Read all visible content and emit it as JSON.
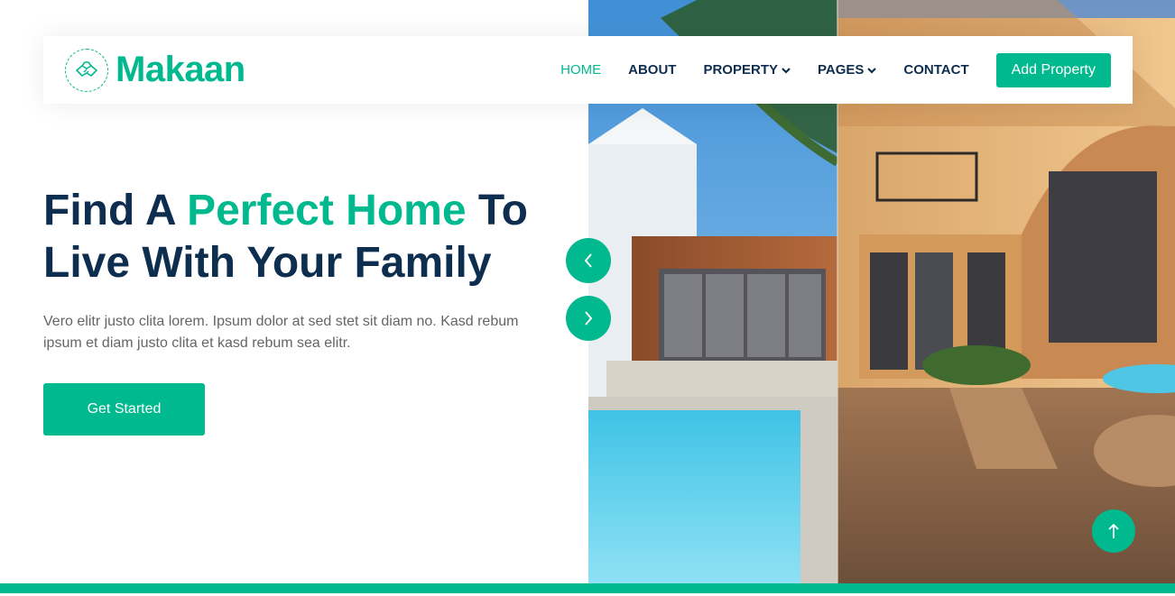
{
  "brand": {
    "name": "Makaan",
    "logo_icon": "handshake-icon"
  },
  "nav": {
    "items": [
      {
        "label": "HOME",
        "active": true,
        "dropdown": false
      },
      {
        "label": "ABOUT",
        "active": false,
        "dropdown": false
      },
      {
        "label": "PROPERTY",
        "active": false,
        "dropdown": true
      },
      {
        "label": "PAGES",
        "active": false,
        "dropdown": true
      },
      {
        "label": "CONTACT",
        "active": false,
        "dropdown": false
      }
    ],
    "cta_label": "Add Property"
  },
  "hero": {
    "title_part1": "Find A ",
    "title_accent": "Perfect Home",
    "title_part2": " To Live With Your Family",
    "text": "Vero elitr justo clita lorem. Ipsum dolor at sed stet sit diam no. Kasd rebum ipsum et diam justo clita et kasd rebum sea elitr.",
    "button_label": "Get Started"
  },
  "carousel": {
    "prev_icon": "chevron-left-icon",
    "next_icon": "chevron-right-icon"
  },
  "back_to_top_icon": "arrow-up-icon",
  "colors": {
    "primary": "#00b98e",
    "dark": "#0e2e50",
    "text": "#666565"
  }
}
